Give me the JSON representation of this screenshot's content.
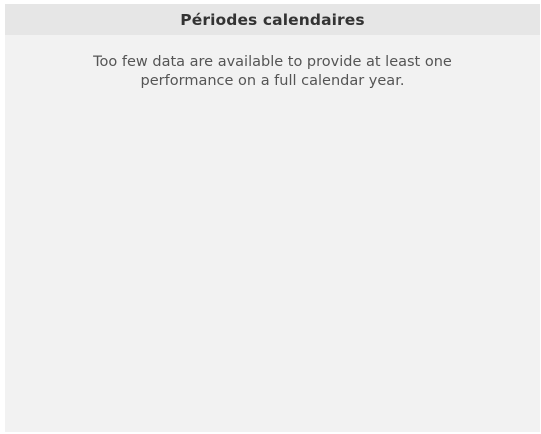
{
  "panel": {
    "title": "Périodes calendaires",
    "message": "Too few data are available to provide at least one performance on a full calendar year."
  }
}
